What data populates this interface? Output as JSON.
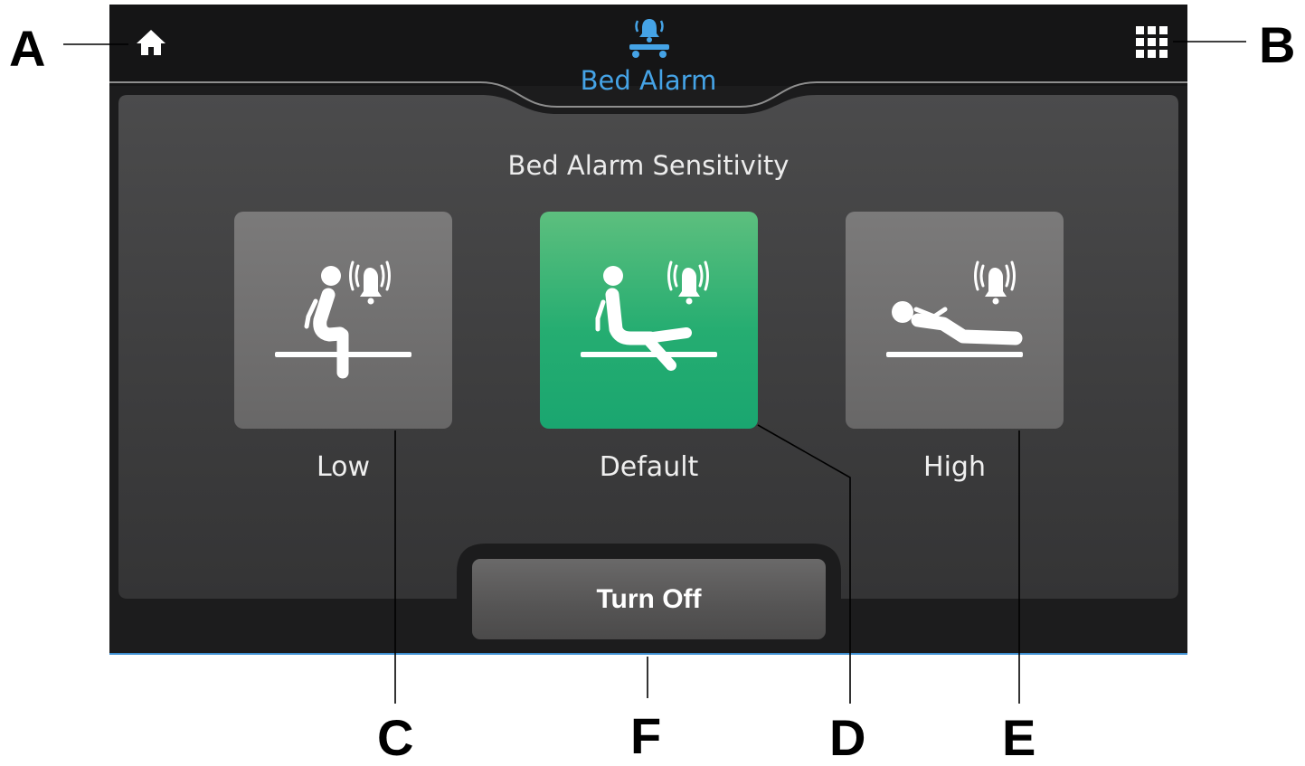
{
  "callouts": {
    "a": "A",
    "b": "B",
    "c": "C",
    "d": "D",
    "e": "E",
    "f": "F"
  },
  "header": {
    "title": "Bed Alarm",
    "title_icon": "bed-alarm-icon",
    "home_icon": "home-icon",
    "menu_icon": "grid-menu-icon"
  },
  "section": {
    "title": "Bed Alarm Sensitivity"
  },
  "options": [
    {
      "label": "Low",
      "icon": "sitting-up-alarm-icon",
      "selected": false
    },
    {
      "label": "Default",
      "icon": "reclining-alarm-icon",
      "selected": true
    },
    {
      "label": "High",
      "icon": "lying-down-alarm-icon",
      "selected": false
    }
  ],
  "turn_off": {
    "label": "Turn Off"
  },
  "colors": {
    "accent": "#45a3e6",
    "selected": "#25ad71",
    "tile": "#7b7a7a",
    "background": "#1c1c1d"
  }
}
